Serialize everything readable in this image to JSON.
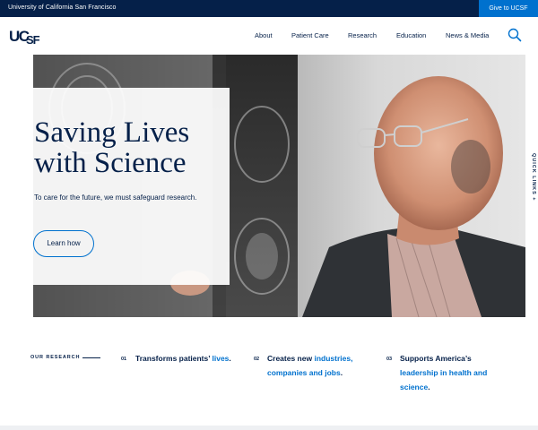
{
  "utility": {
    "university": "University of California San Francisco",
    "give": "Give to UCSF"
  },
  "header": {
    "logo_text": "UCSF",
    "nav": [
      "About",
      "Patient Care",
      "Research",
      "Education",
      "News & Media"
    ]
  },
  "hero": {
    "title": "Saving Lives with Science",
    "subtitle": "To care for the future, we must safeguard research.",
    "button": "Learn how"
  },
  "quick_links": "QUICK LINKS +",
  "research": {
    "label": "OUR RESEARCH",
    "items": [
      {
        "num": "01",
        "text": "Transforms patients’ ",
        "link": "lives",
        "after": "."
      },
      {
        "num": "02",
        "text": "Creates new ",
        "link": "industries, companies and jobs",
        "after": "."
      },
      {
        "num": "03",
        "text": "Supports America’s ",
        "link": "leadership in health and science",
        "after": "."
      }
    ]
  },
  "colors": {
    "navy": "#052049",
    "blue": "#0071ce"
  }
}
